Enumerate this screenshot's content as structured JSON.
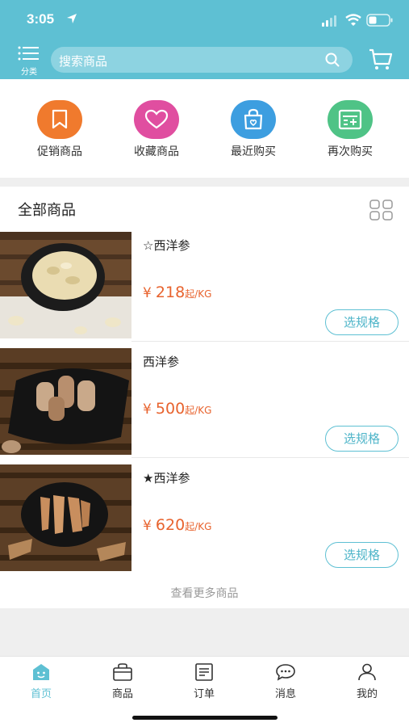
{
  "status_bar": {
    "time": "3:05"
  },
  "header": {
    "category_label": "分类",
    "search_placeholder": "搜索商品"
  },
  "quick_actions": [
    {
      "label": "促销商品",
      "icon": "bookmark-icon",
      "color": "#f07a2d"
    },
    {
      "label": "收藏商品",
      "icon": "heart-icon",
      "color": "#e04ea0"
    },
    {
      "label": "最近购买",
      "icon": "shopping-bag-icon",
      "color": "#3d9ee0"
    },
    {
      "label": "再次购买",
      "icon": "receipt-icon",
      "color": "#4fc386"
    }
  ],
  "product_section": {
    "title": "全部商品",
    "more_label": "查看更多商品",
    "items": [
      {
        "name": "☆西洋参",
        "currency": "¥",
        "price": "218",
        "unit": "起/KG",
        "button": "选规格"
      },
      {
        "name": "西洋参",
        "currency": "¥",
        "price": "500",
        "unit": "起/KG",
        "button": "选规格"
      },
      {
        "name": "★西洋参",
        "currency": "¥",
        "price": "620",
        "unit": "起/KG",
        "button": "选规格"
      }
    ]
  },
  "tabs": [
    {
      "label": "首页",
      "icon": "home-icon",
      "active": true
    },
    {
      "label": "商品",
      "icon": "bag-icon",
      "active": false
    },
    {
      "label": "订单",
      "icon": "order-icon",
      "active": false
    },
    {
      "label": "消息",
      "icon": "message-icon",
      "active": false
    },
    {
      "label": "我的",
      "icon": "user-icon",
      "active": false
    }
  ],
  "colors": {
    "brand": "#5ec0d3",
    "price": "#e8632e"
  }
}
